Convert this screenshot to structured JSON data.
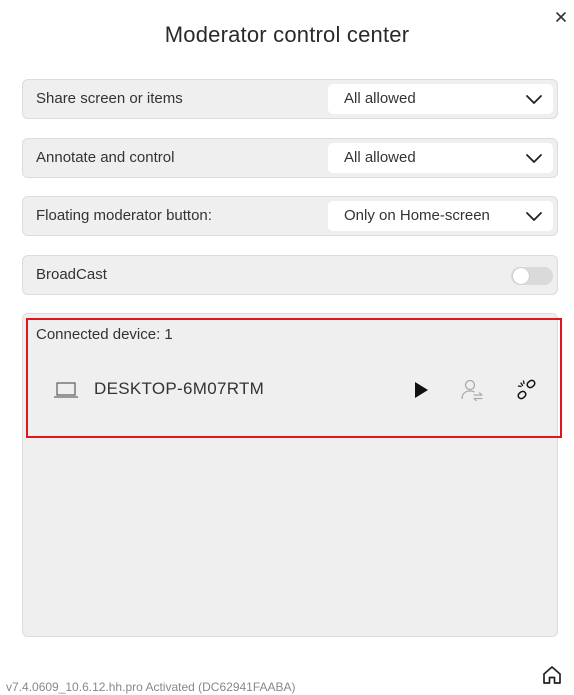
{
  "dialog": {
    "title": "Moderator control center",
    "close_icon": "close-icon"
  },
  "settings": [
    {
      "label": "Share screen or items",
      "value": "All allowed"
    },
    {
      "label": "Annotate and control",
      "value": "All allowed"
    },
    {
      "label": "Floating moderator button:",
      "value": "Only on Home-screen"
    }
  ],
  "broadcast": {
    "label": "BroadCast",
    "enabled": false
  },
  "devices": {
    "connected_label": "Connected device: 1",
    "items": [
      {
        "name": "DESKTOP-6M07RTM",
        "icon": "laptop-icon",
        "actions": [
          "play-icon",
          "user-transfer-icon",
          "unlink-icon"
        ]
      }
    ]
  },
  "footer": {
    "version": "v7.4.0609_10.6.12.hh.pro Activated (DC62941FAABA)",
    "home_icon": "home-icon"
  },
  "colors": {
    "highlight_border": "#e0161b",
    "row_background": "#efefef",
    "toggle_off": "#dadada"
  }
}
